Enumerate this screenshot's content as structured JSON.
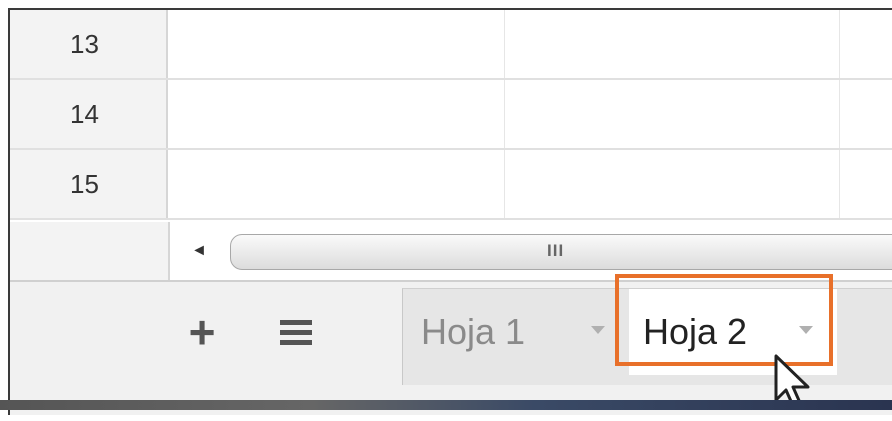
{
  "rows": [
    {
      "number": "13"
    },
    {
      "number": "14"
    },
    {
      "number": "15"
    }
  ],
  "scrollbar": {
    "left_arrow_icon": "arrow-left-icon",
    "grip_label": "III"
  },
  "sheet_bar": {
    "add_icon": "plus-icon",
    "add_symbol": "+",
    "menu_icon": "hamburger-menu-icon",
    "tabs": [
      {
        "label": "Hoja 1",
        "active": false,
        "menu_icon": "chevron-down-icon"
      },
      {
        "label": "Hoja 2",
        "active": true,
        "menu_icon": "chevron-down-icon"
      }
    ]
  },
  "colors": {
    "highlight": "#e8702a",
    "tabbar_background": "#f1f1f1",
    "row_header_background": "#f3f3f3"
  }
}
